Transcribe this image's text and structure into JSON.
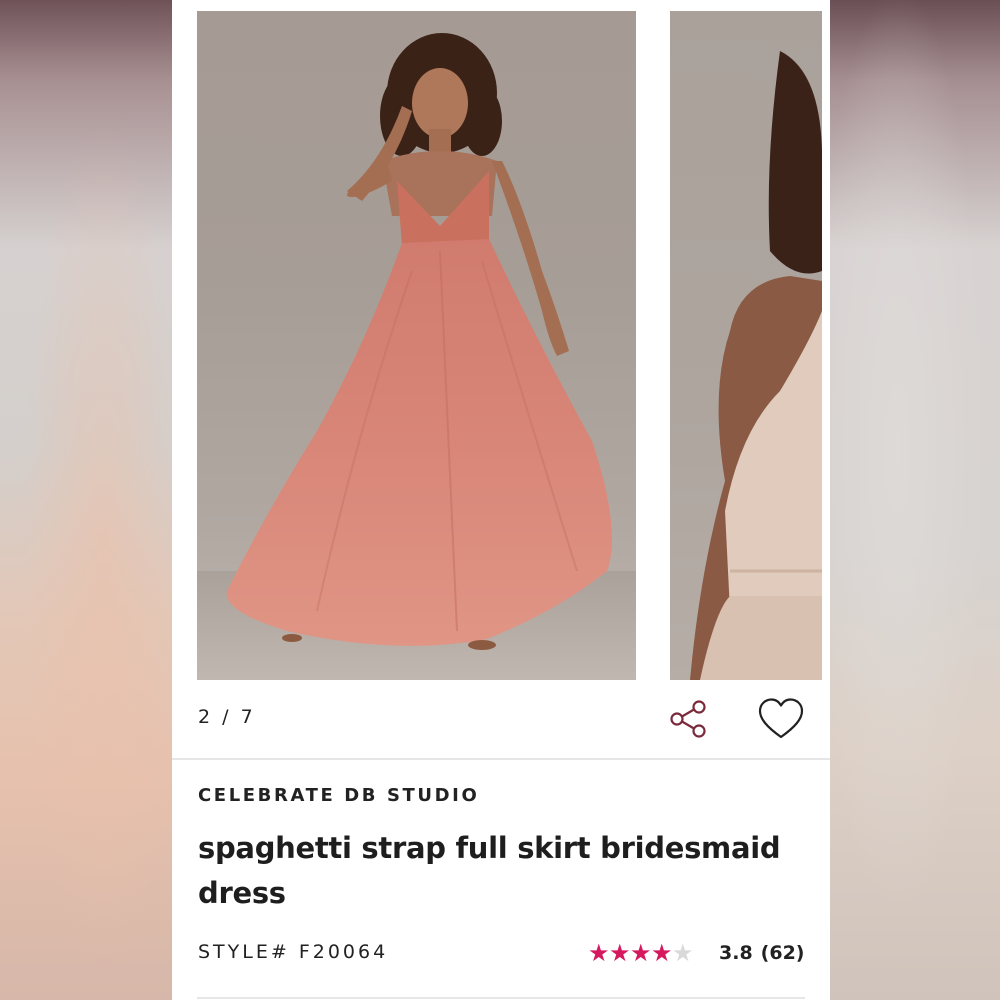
{
  "gallery": {
    "counter": "2 / 7",
    "main_photo": "pink spaghetti strap full skirt bridesmaid dress, front view",
    "next_photo": "champagne dress, back view"
  },
  "actions": {
    "share_icon": "share-icon",
    "favorite_icon": "heart-icon"
  },
  "product": {
    "brand": "CELEBRATE DB STUDIO",
    "title": "spaghetti strap full skirt bridesmaid dress",
    "style": "STYLE# F20064",
    "rating": {
      "stars_filled": 3.8,
      "stars_total": 5,
      "value": "3.8",
      "count": "(62)"
    }
  },
  "colors": {
    "star_filled": "#d6185f",
    "star_empty": "#d9d9d9",
    "icon_stroke": "#7a2a3a",
    "text": "#222222"
  }
}
